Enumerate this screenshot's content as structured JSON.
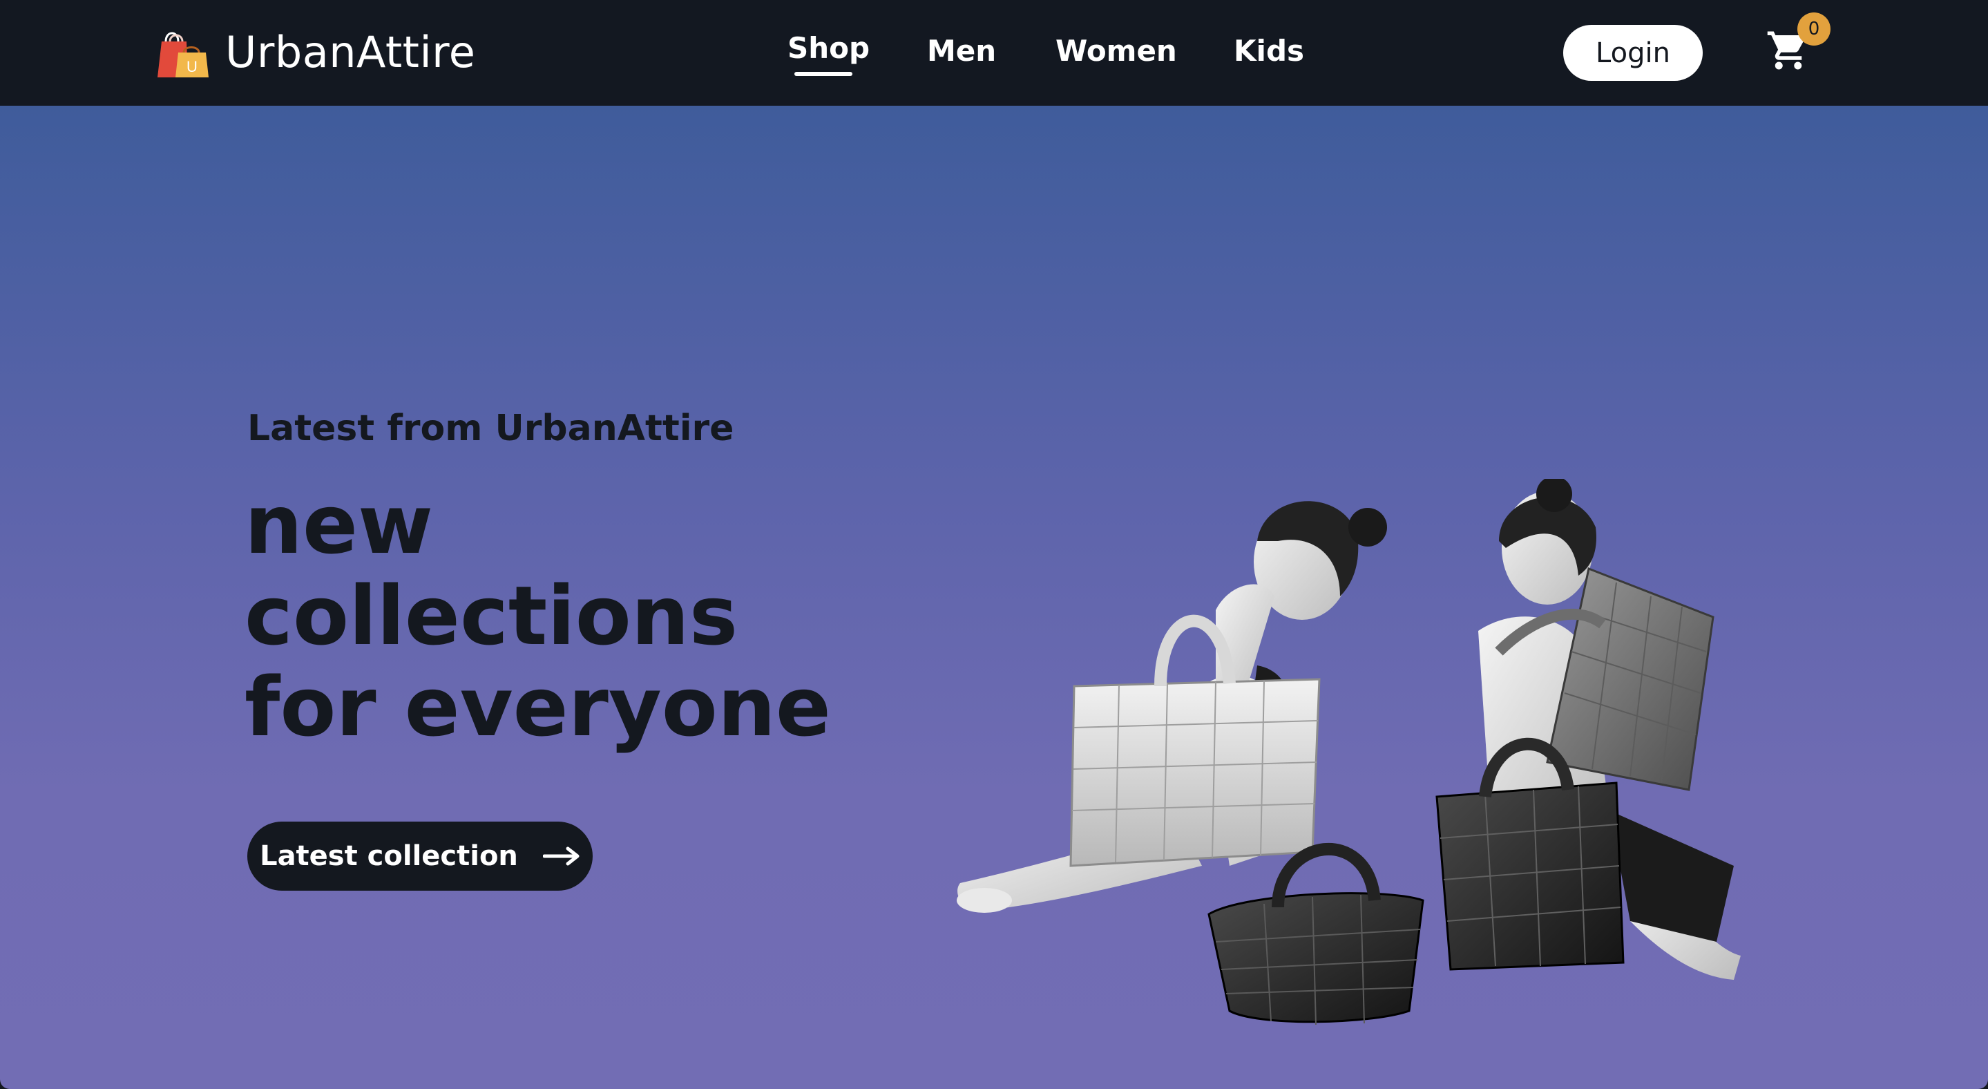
{
  "brand": {
    "name": "UrbanAttire",
    "logo_icon": "shopping-bag-icon",
    "logo_letter": "U"
  },
  "nav": {
    "links": [
      {
        "label": "Shop",
        "active": true
      },
      {
        "label": "Men",
        "active": false
      },
      {
        "label": "Women",
        "active": false
      },
      {
        "label": "Kids",
        "active": false
      }
    ],
    "login_label": "Login",
    "cart_icon": "cart-icon",
    "cart_count": "0"
  },
  "hero": {
    "kicker": "Latest from UrbanAttire",
    "title_lines": [
      "new",
      "collections",
      "for everyone"
    ],
    "cta_label": "Latest collection",
    "cta_icon": "arrow-right-icon",
    "image_subject": "two models posing with quilted handbags"
  },
  "colors": {
    "nav_background": "#131821",
    "hero_gradient_top": "#3f5c9b",
    "hero_gradient_bottom": "#726db4",
    "text_dark": "#14181f",
    "badge": "#e2a13d",
    "logo_bag_red": "#e24a3b",
    "logo_bag_yellow": "#f2b84b"
  }
}
